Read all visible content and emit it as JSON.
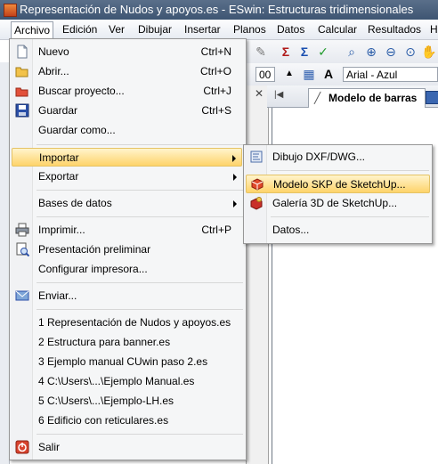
{
  "window": {
    "title": "Representación de Nudos y apoyos.es - ESwin: Estructuras tridimensionales"
  },
  "menubar": {
    "items": [
      "Archivo",
      "Edición",
      "Ver",
      "Dibujar",
      "Insertar",
      "Planos",
      "Datos",
      "Calcular",
      "Resultados",
      "H"
    ]
  },
  "toolbar": {
    "number_combo_value": "00",
    "font_combo_value": "Arial - Azul"
  },
  "tabs": {
    "active_label": "Modelo de barras"
  },
  "file_menu": {
    "items": [
      {
        "label": "Nuevo",
        "shortcut": "Ctrl+N",
        "icon": "new-document-icon"
      },
      {
        "label": "Abrir...",
        "shortcut": "Ctrl+O",
        "icon": "open-folder-icon"
      },
      {
        "label": "Buscar proyecto...",
        "shortcut": "Ctrl+J",
        "icon": "search-folder-icon"
      },
      {
        "label": "Guardar",
        "shortcut": "Ctrl+S",
        "icon": "save-icon"
      },
      {
        "label": "Guardar como...",
        "shortcut": ""
      },
      {
        "label": "Importar",
        "shortcut": ""
      },
      {
        "label": "Exportar",
        "shortcut": ""
      },
      {
        "label": "Bases de datos",
        "shortcut": ""
      },
      {
        "label": "Imprimir...",
        "shortcut": "Ctrl+P",
        "icon": "printer-icon"
      },
      {
        "label": "Presentación preliminar",
        "shortcut": "",
        "icon": "print-preview-icon"
      },
      {
        "label": "Configurar impresora...",
        "shortcut": ""
      },
      {
        "label": "Enviar...",
        "shortcut": "",
        "icon": "send-icon"
      },
      {
        "label": "1 Representación de Nudos y apoyos.es"
      },
      {
        "label": "2 Estructura para banner.es"
      },
      {
        "label": "3 Ejemplo manual CUwin paso 2.es"
      },
      {
        "label": "4 C:\\Users\\...\\Ejemplo Manual.es"
      },
      {
        "label": "5 C:\\Users\\...\\Ejemplo-LH.es"
      },
      {
        "label": "6 Edificio con reticulares.es"
      },
      {
        "label": "Salir",
        "icon": "exit-icon"
      }
    ]
  },
  "import_submenu": {
    "items": [
      {
        "label": "Dibujo DXF/DWG...",
        "icon": "dxf-icon"
      },
      {
        "label": "Modelo SKP de SketchUp...",
        "icon": "sketchup-icon"
      },
      {
        "label": "Galería 3D de SketchUp...",
        "icon": "sketchup-gallery-icon"
      },
      {
        "label": "Datos..."
      }
    ]
  },
  "colors": {
    "highlight": "#fed36a",
    "titlebar": "#4a607e"
  }
}
